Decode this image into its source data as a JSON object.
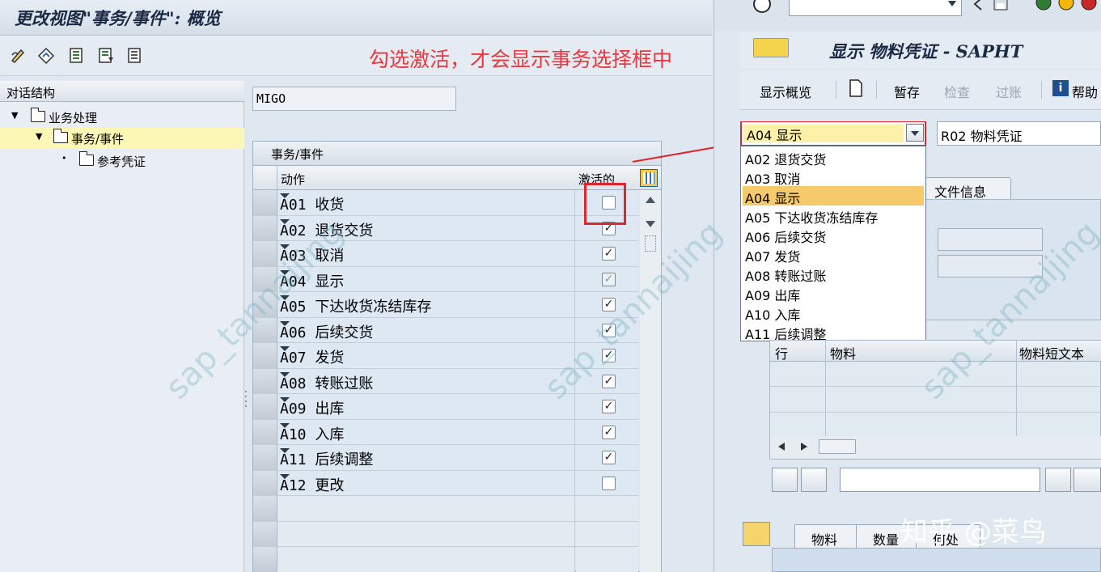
{
  "left_window": {
    "title": "更改视图\"事务/事件\": 概览",
    "annotation": "勾选激活，才会显示事务选择框中",
    "tree": {
      "header": "对话结构",
      "items": [
        {
          "label": "业务处理"
        },
        {
          "label": "事务/事件"
        },
        {
          "label": "参考凭证"
        }
      ]
    },
    "filter_value": "MIGO",
    "table": {
      "title": "事务/事件",
      "col_action": "动作",
      "col_active": "激活的",
      "rows": [
        {
          "action": "A01 收货",
          "active": false
        },
        {
          "action": "A02 退货交货",
          "active": true
        },
        {
          "action": "A03 取消",
          "active": true
        },
        {
          "action": "A04 显示",
          "active": true
        },
        {
          "action": "A05 下达收货冻结库存",
          "active": true
        },
        {
          "action": "A06 后续交货",
          "active": true
        },
        {
          "action": "A07 发货",
          "active": true
        },
        {
          "action": "A08 转账过账",
          "active": true
        },
        {
          "action": "A09 出库",
          "active": true
        },
        {
          "action": "A10 入库",
          "active": true
        },
        {
          "action": "A11 后续调整",
          "active": true
        },
        {
          "action": "A12 更改",
          "active": false
        }
      ]
    }
  },
  "right_window": {
    "title": "显示 物料凭证 - SAPHT",
    "toolbar": {
      "overview": "显示概览",
      "save": "暂存",
      "check": "检查",
      "post": "过账",
      "help": "帮助"
    },
    "action_combo": "A04 显示",
    "ref_combo": "R02 物料凭证",
    "dropdown_options": [
      "A02 退货交货",
      "A03 取消",
      "A04 显示",
      "A05 下达收货冻结库存",
      "A06 后续交货",
      "A07 发货",
      "A08 转账过账",
      "A09 出库",
      "A10 入库",
      "A11 后续调整"
    ],
    "highlighted_option": "A04 显示",
    "tab_file_info": "文件信息",
    "grid": {
      "col_line": "行",
      "col_material": "物料",
      "col_short_text": "物料短文本"
    },
    "bottom_tabs": [
      "物料",
      "数量",
      "何处"
    ]
  },
  "watermarks": {
    "tiled": "sap_tannaijing",
    "site": "知乎 @菜鸟"
  },
  "colors": {
    "annotation_red": "#e8383d",
    "highlight_yellow": "#fdf7b5",
    "option_highlight": "#f6c96a"
  }
}
